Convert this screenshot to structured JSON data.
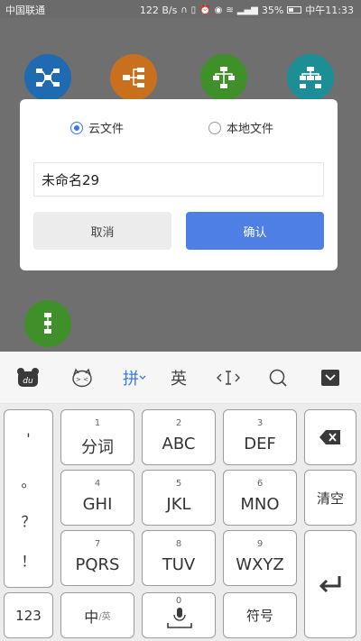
{
  "statusbar": {
    "carrier": "中国联通",
    "speed": "122 B/s",
    "battery": "35%",
    "time": "中午11:33"
  },
  "dialog": {
    "option_cloud": "云文件",
    "option_local": "本地文件",
    "selected": "cloud",
    "name_value": "未命名29",
    "cancel_label": "取消",
    "confirm_label": "确认"
  },
  "toolbar": {
    "pinyin_label": "拼",
    "english_label": "英",
    "icons": [
      "du-logo-icon",
      "emoji-face-icon",
      "pinyin-dropdown-icon",
      "english-toggle",
      "cursor-move-icon",
      "search-icon",
      "hide-keyboard-icon"
    ]
  },
  "keys": {
    "k1": {
      "num": "1",
      "label": "分词"
    },
    "k2": {
      "num": "2",
      "label": "ABC"
    },
    "k3": {
      "num": "3",
      "label": "DEF"
    },
    "k4": {
      "num": "4",
      "label": "GHI"
    },
    "k5": {
      "num": "5",
      "label": "JKL"
    },
    "k6": {
      "num": "6",
      "label": "MNO"
    },
    "k7": {
      "num": "7",
      "label": "PQRS"
    },
    "k8": {
      "num": "8",
      "label": "TUV"
    },
    "k9": {
      "num": "9",
      "label": "WXYZ"
    },
    "k0": {
      "num": "0"
    },
    "clear": "清空",
    "num123": "123",
    "lang_main": "中",
    "lang_sub": "/英",
    "symbols": "符号",
    "punct": [
      "'",
      "。",
      "？",
      "！"
    ]
  },
  "colors": {
    "accent": "#4e7fe5",
    "tpl_blue": "#1f6ab0",
    "tpl_orange": "#c8701e",
    "tpl_green": "#3f8f2a",
    "tpl_teal": "#1c8f96"
  }
}
